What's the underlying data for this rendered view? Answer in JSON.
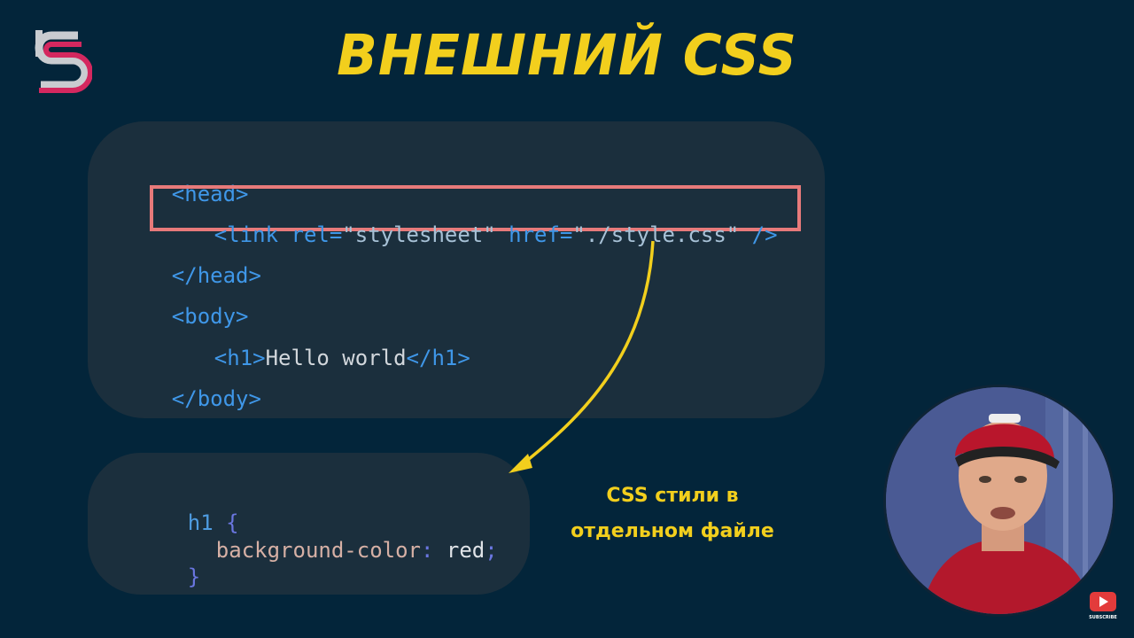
{
  "title": "ВНЕШНИЙ CSS",
  "html_code": {
    "line1": "<head>",
    "line2_open": "<link ",
    "line2_attr1": "rel=",
    "line2_val1": "\"stylesheet\"",
    "line2_attr2": " href=",
    "line2_val2": "\"./style.css\"",
    "line2_close": " />",
    "line3": "</head>",
    "line4": "<body>",
    "line5_open": "<h1>",
    "line5_text": "Hello world",
    "line5_close": "</h1>",
    "line6": "</body>"
  },
  "css_code": {
    "selector": "h1",
    "open_brace": " {",
    "property": "background-color",
    "colon": ": ",
    "value": "red",
    "semicolon": ";",
    "close_brace": "}"
  },
  "note": {
    "line1": "CSS стили в",
    "line2": "отдельном файле"
  },
  "colors": {
    "background": "#03253a",
    "card": "#1b2f3d",
    "accent_yellow": "#f2cf1d",
    "highlight_border": "#e77a7a",
    "tag_blue": "#3f97e8"
  },
  "icons": {
    "logo": "s-logo-icon",
    "subscribe": "youtube-subscribe-icon"
  },
  "subscribe_label": "SUBSCRIBE"
}
